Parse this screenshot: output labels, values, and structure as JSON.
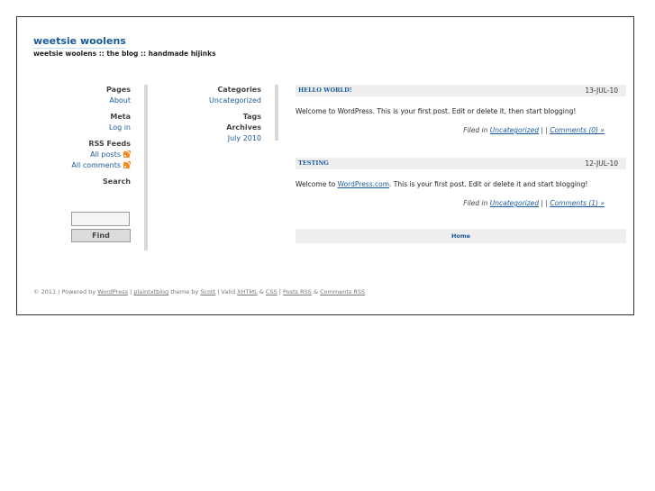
{
  "site": {
    "title": "weetsie woolens",
    "description": "weetsie woolens :: the blog :: handmade hijinks"
  },
  "sidebar1": {
    "pages_heading": "Pages",
    "about_link": "About",
    "meta_heading": "Meta",
    "login_link": "Log in",
    "rss_heading": "RSS Feeds",
    "all_posts": "All posts",
    "all_comments": "All comments",
    "search_heading": "Search",
    "search_value": "",
    "find_label": "Find"
  },
  "sidebar2": {
    "categories_heading": "Categories",
    "uncategorized": "Uncategorized",
    "tags_heading": "Tags",
    "archives_heading": "Archives",
    "archive_month": "July 2010"
  },
  "posts": [
    {
      "title": "HELLO WORLD!",
      "date": "13-JUL-10",
      "body": "Welcome to WordPress. This is your first post. Edit or delete it, then start blogging!",
      "filed_prefix": "Filed in ",
      "category": "Uncategorized",
      "separator": " | | ",
      "comments": "Comments (0) »"
    },
    {
      "title": "TESTING",
      "date": "12-JUL-10",
      "body_before": "Welcome to ",
      "body_link": "WordPress.com",
      "body_after": ". This is your first post. Edit or delete it and start blogging!",
      "filed_prefix": "Filed in ",
      "category": "Uncategorized",
      "separator": " | | ",
      "comments": "Comments (1) »"
    }
  ],
  "nav": {
    "home": "Home"
  },
  "footer": {
    "copyright": "© 2011 | Powered by ",
    "wordpress": "WordPress",
    "sep1": " | ",
    "theme": "plaintxtblog",
    "theme_by": " theme by ",
    "author": "Scott",
    "valid": " | Valid ",
    "xhtml": "XHTML",
    "amp": " & ",
    "css": "CSS",
    "sep2": " | ",
    "posts_rss": "Posts RSS",
    "amp2": " & ",
    "comments_rss": "Comments RSS"
  },
  "icons": {
    "rss": "rss-feed-icon"
  },
  "colors": {
    "link": "#1a5a9a",
    "rss": "#f28c1e",
    "bar": "#eeeeee"
  }
}
